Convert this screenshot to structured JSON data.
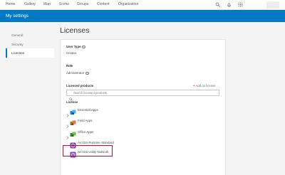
{
  "nav": {
    "items": [
      "Home",
      "Gallery",
      "Map",
      "Scene",
      "Groups",
      "Content",
      "Organization"
    ]
  },
  "header": {
    "title": "My settings"
  },
  "sidebar": {
    "items": [
      {
        "label": "General"
      },
      {
        "label": "Security"
      },
      {
        "label": "Licenses"
      }
    ]
  },
  "page": {
    "title": "Licenses"
  },
  "user_type": {
    "label": "User Type",
    "value": "Creator"
  },
  "role": {
    "label": "Role",
    "value": "Administrator"
  },
  "licensed_products": {
    "label": "Licensed products",
    "add_label": "Add on license",
    "search_placeholder": "Search licensed products",
    "license_label": "License"
  },
  "products": [
    {
      "label": "Essential Apps",
      "icon": "essential-apps-icon",
      "expandable": true
    },
    {
      "label": "Field Apps",
      "icon": "field-apps-icon",
      "expandable": true
    },
    {
      "label": "Office Apps",
      "icon": "office-apps-icon",
      "expandable": true
    },
    {
      "label": "ArcGIS Runtime Standard",
      "icon": "runtime-icon",
      "expandable": false
    },
    {
      "label": "ArcGIS Utility Network",
      "icon": "utility-network-icon",
      "expandable": false
    }
  ],
  "colors": {
    "brand_blue": "#0079c1",
    "highlight_red": "#c8102e",
    "product_purple": "#7b3fb6"
  }
}
